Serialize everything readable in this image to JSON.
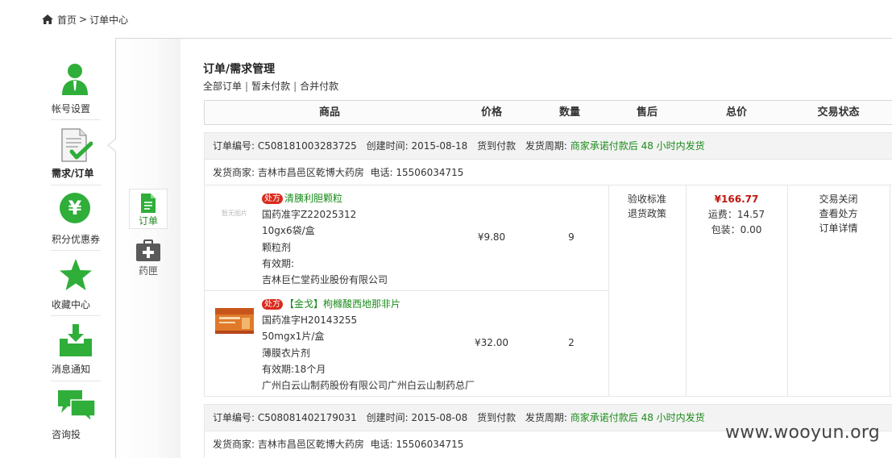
{
  "breadcrumb": {
    "home": "首页",
    "separator": ">",
    "current": "订单中心"
  },
  "leftnav": {
    "items": [
      {
        "label": "帐号设置",
        "icon": "user-icon"
      },
      {
        "label": "需求/订单",
        "icon": "document-check-icon",
        "active": true
      },
      {
        "label": "积分优惠券",
        "icon": "yen-coin-icon"
      },
      {
        "label": "收藏中心",
        "icon": "star-icon"
      },
      {
        "label": "消息通知",
        "icon": "inbox-download-icon"
      },
      {
        "label": "咨询投",
        "icon": "chat-bubbles-icon"
      }
    ]
  },
  "subnav": {
    "items": [
      {
        "label": "订单",
        "icon": "file-icon",
        "active": true
      },
      {
        "label": "药匣",
        "icon": "medical-kit-icon"
      }
    ]
  },
  "page": {
    "title": "订单/需求管理",
    "filters": [
      "全部订单",
      "暂未付款",
      "合并付款"
    ],
    "filter_separator": "|"
  },
  "table": {
    "columns": [
      "商品",
      "价格",
      "数量",
      "售后",
      "总价",
      "交易状态"
    ]
  },
  "orders": [
    {
      "number_label": "订单编号:",
      "number": "C508181003283725",
      "created_label": "创建时间:",
      "created": "2015-08-18",
      "payment": "货到付款",
      "period_label": "发货周期:",
      "period": "商家承诺付款后 48 小时内发货",
      "shop_label": "发货商家:",
      "shop": "吉林市昌邑区乾博大药房",
      "phone_label": "电话:",
      "phone": "15506034715",
      "products": [
        {
          "badge": "处方",
          "name": "清胰利胆颗粒",
          "approval": "国药准字Z22025312",
          "spec": "10gx6袋/盒",
          "form": "颗粒剂",
          "expiry": "有效期:",
          "maker": "吉林巨仁堂药业股份有限公司",
          "thumb_placeholder": "暂无图片",
          "price": "¥9.80",
          "qty": "9"
        },
        {
          "badge": "处方",
          "name": "【金戈】枸橼酸西地那非片",
          "approval": "国药准字H20143255",
          "spec": "50mgx1片/盒",
          "form": "薄膜衣片剂",
          "expiry": "有效期:18个月",
          "maker": "广州白云山制药股份有限公司广州白云山制药总厂",
          "price": "¥32.00",
          "qty": "2"
        }
      ],
      "aftersale": [
        "验收标准",
        "退货政策"
      ],
      "total": "¥166.77",
      "shipping": "运费：14.57",
      "packing": "包装：0.00",
      "status_links": [
        "交易关闭",
        "查看处方",
        "订单详情"
      ]
    },
    {
      "number_label": "订单编号:",
      "number": "C508081402179031",
      "created_label": "创建时间:",
      "created": "2015-08-08",
      "payment": "货到付款",
      "period_label": "发货周期:",
      "period": "商家承诺付款后 48 小时内发货",
      "shop_label": "发货商家:",
      "shop": "吉林市昌邑区乾博大药房",
      "phone_label": "电话:",
      "phone": "15506034715"
    }
  ],
  "watermark": "www.wooyun.org",
  "colors": {
    "accent_green": "#1a8c1a",
    "price_red": "#c0150c",
    "badge_red": "#d92b1e",
    "icon_green": "#2fae3a"
  }
}
